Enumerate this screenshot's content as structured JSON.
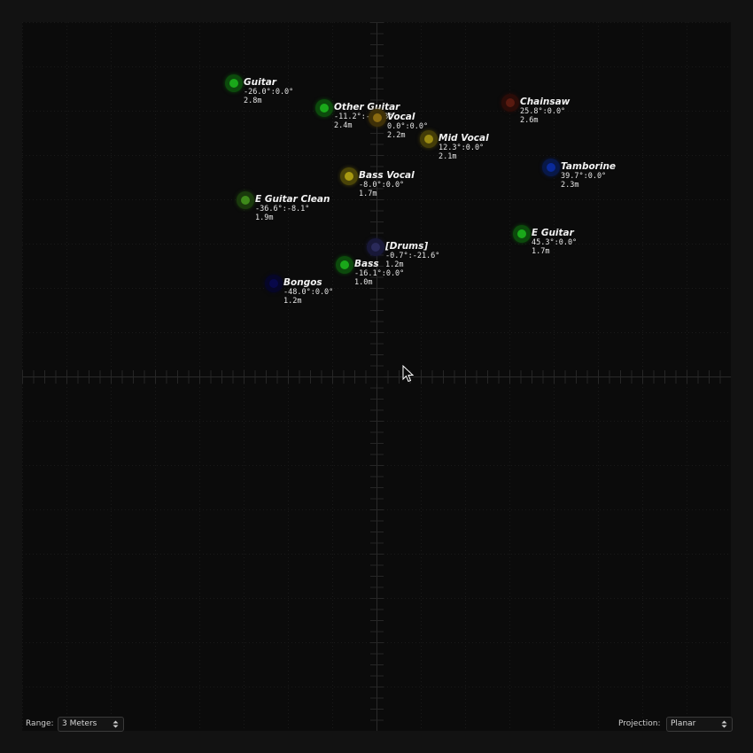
{
  "sources": [
    {
      "name": "Guitar",
      "angle": "-26.0°:0.0°",
      "distance": "2.8m",
      "color": "#1aa81a",
      "glow": "#0c4a0c"
    },
    {
      "name": "Other Guitar",
      "angle": "-11.2°:-15.3°",
      "distance": "2.4m",
      "color": "#1aa81a",
      "glow": "#0c4a0c"
    },
    {
      "name": "Vocal",
      "angle": "0.0°:0.0°",
      "distance": "2.2m",
      "color": "#8a6a10",
      "glow": "#3e3008"
    },
    {
      "name": "Mid Vocal",
      "angle": "12.3°:0.0°",
      "distance": "2.1m",
      "color": "#9a8a12",
      "glow": "#433c08"
    },
    {
      "name": "Chainsaw",
      "angle": "25.8°:0.0°",
      "distance": "2.6m",
      "color": "#5a1a10",
      "glow": "#2a0c08"
    },
    {
      "name": "Tamborine",
      "angle": "39.7°:0.0°",
      "distance": "2.3m",
      "color": "#0a2a9a",
      "glow": "#081848"
    },
    {
      "name": "Bass Vocal",
      "angle": "-8.0°:0.0°",
      "distance": "1.7m",
      "color": "#a89a12",
      "glow": "#4a4408"
    },
    {
      "name": "E Guitar Clean",
      "angle": "-36.6°:-8.1°",
      "distance": "1.9m",
      "color": "#3e8a1a",
      "glow": "#1a3a0c"
    },
    {
      "name": "E Guitar",
      "angle": "45.3°:0.0°",
      "distance": "1.7m",
      "color": "#1aa81a",
      "glow": "#0c4a0c"
    },
    {
      "name": "[Drums]",
      "angle": "-0.7°:-21.6°",
      "distance": "1.2m",
      "color": "#2a2a5a",
      "glow": "#181838"
    },
    {
      "name": "Bass",
      "angle": "-16.1°:0.0°",
      "distance": "1.0m",
      "color": "#1aa81a",
      "glow": "#0c4a0c"
    },
    {
      "name": "Bongos",
      "angle": "-48.0°:0.0°",
      "distance": "1.2m",
      "color": "#08084a",
      "glow": "#060628"
    }
  ],
  "range": {
    "label": "Range:",
    "value": "3 Meters"
  },
  "projection": {
    "label": "Projection:",
    "value": "Planar"
  },
  "icons": {
    "dropdown": "updown-arrows-icon",
    "cursor": "mouse-pointer-icon"
  }
}
